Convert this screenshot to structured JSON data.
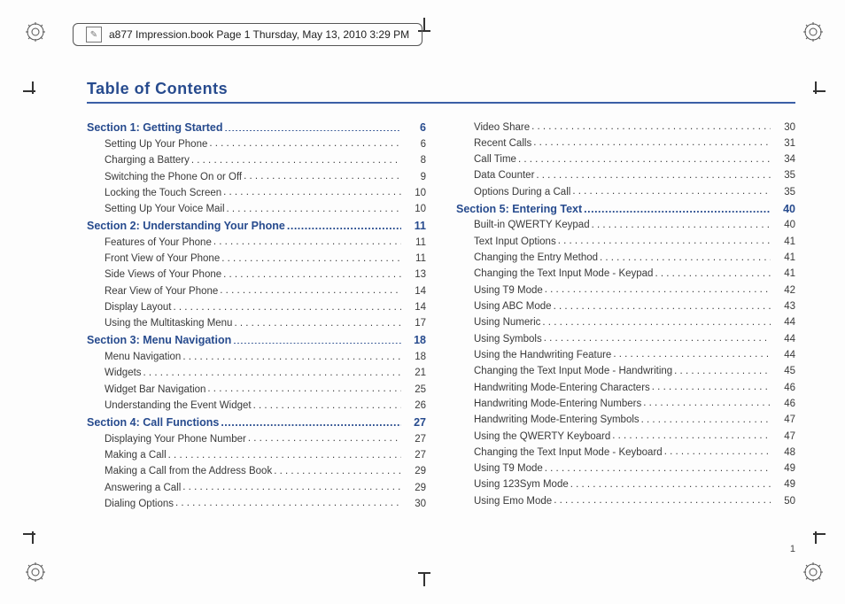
{
  "header": {
    "text": "a877 Impression.book  Page 1  Thursday, May 13, 2010  3:29 PM"
  },
  "title": "Table of Contents",
  "footer_page": "1",
  "left_column": [
    {
      "type": "section",
      "label": "Section 1:  Getting Started",
      "page": "6"
    },
    {
      "type": "sub",
      "label": "Setting Up Your Phone",
      "page": "6"
    },
    {
      "type": "sub",
      "label": "Charging a Battery",
      "page": "8"
    },
    {
      "type": "sub",
      "label": "Switching the Phone On or Off",
      "page": "9"
    },
    {
      "type": "sub",
      "label": "Locking the Touch Screen",
      "page": "10"
    },
    {
      "type": "sub",
      "label": "Setting Up Your Voice Mail",
      "page": "10"
    },
    {
      "type": "section",
      "label": "Section 2:  Understanding Your Phone",
      "page": "11"
    },
    {
      "type": "sub",
      "label": "Features of Your Phone",
      "page": "11"
    },
    {
      "type": "sub",
      "label": "Front View of Your Phone",
      "page": "11"
    },
    {
      "type": "sub",
      "label": "Side Views of Your Phone",
      "page": "13"
    },
    {
      "type": "sub",
      "label": "Rear View of Your Phone",
      "page": "14"
    },
    {
      "type": "sub",
      "label": "Display Layout",
      "page": "14"
    },
    {
      "type": "sub",
      "label": "Using the Multitasking Menu",
      "page": "17"
    },
    {
      "type": "section",
      "label": "Section 3:  Menu Navigation",
      "page": "18"
    },
    {
      "type": "sub",
      "label": "Menu Navigation",
      "page": "18"
    },
    {
      "type": "sub",
      "label": "Widgets",
      "page": "21"
    },
    {
      "type": "sub",
      "label": "Widget Bar Navigation",
      "page": "25"
    },
    {
      "type": "sub",
      "label": "Understanding the Event Widget",
      "page": "26"
    },
    {
      "type": "section",
      "label": "Section 4:  Call Functions",
      "page": "27"
    },
    {
      "type": "sub",
      "label": "Displaying Your Phone Number",
      "page": "27"
    },
    {
      "type": "sub",
      "label": "Making a Call",
      "page": "27"
    },
    {
      "type": "sub",
      "label": "Making a Call from the Address Book",
      "page": "29"
    },
    {
      "type": "sub",
      "label": "Answering a Call",
      "page": "29"
    },
    {
      "type": "sub",
      "label": "Dialing Options",
      "page": "30"
    }
  ],
  "right_column": [
    {
      "type": "sub",
      "label": "Video Share",
      "page": "30"
    },
    {
      "type": "sub",
      "label": "Recent Calls",
      "page": "31"
    },
    {
      "type": "sub",
      "label": "Call Time",
      "page": "34"
    },
    {
      "type": "sub",
      "label": "Data Counter",
      "page": "35"
    },
    {
      "type": "sub",
      "label": "Options During a Call",
      "page": "35"
    },
    {
      "type": "section",
      "label": "Section 5:  Entering Text",
      "page": "40"
    },
    {
      "type": "sub",
      "label": "Built-in QWERTY Keypad",
      "page": "40"
    },
    {
      "type": "sub",
      "label": "Text Input Options",
      "page": "41"
    },
    {
      "type": "sub",
      "label": "Changing the Entry Method",
      "page": "41"
    },
    {
      "type": "sub",
      "label": "Changing the Text Input Mode - Keypad",
      "page": "41"
    },
    {
      "type": "sub",
      "label": "Using T9 Mode",
      "page": "42"
    },
    {
      "type": "sub",
      "label": "Using ABC Mode",
      "page": "43"
    },
    {
      "type": "sub",
      "label": "Using Numeric",
      "page": "44"
    },
    {
      "type": "sub",
      "label": "Using Symbols",
      "page": "44"
    },
    {
      "type": "sub",
      "label": "Using the Handwriting Feature",
      "page": "44"
    },
    {
      "type": "sub",
      "label": "Changing the Text Input Mode - Handwriting",
      "page": "45"
    },
    {
      "type": "sub",
      "label": "Handwriting Mode-Entering Characters",
      "page": "46"
    },
    {
      "type": "sub",
      "label": "Handwriting Mode-Entering Numbers",
      "page": "46"
    },
    {
      "type": "sub",
      "label": "Handwriting Mode-Entering Symbols",
      "page": "47"
    },
    {
      "type": "sub",
      "label": "Using the QWERTY Keyboard",
      "page": "47"
    },
    {
      "type": "sub",
      "label": "Changing the Text Input Mode - Keyboard",
      "page": "48"
    },
    {
      "type": "sub",
      "label": "Using T9 Mode",
      "page": "49"
    },
    {
      "type": "sub",
      "label": "Using 123Sym Mode",
      "page": "49"
    },
    {
      "type": "sub",
      "label": "Using Emo Mode",
      "page": "50"
    }
  ]
}
